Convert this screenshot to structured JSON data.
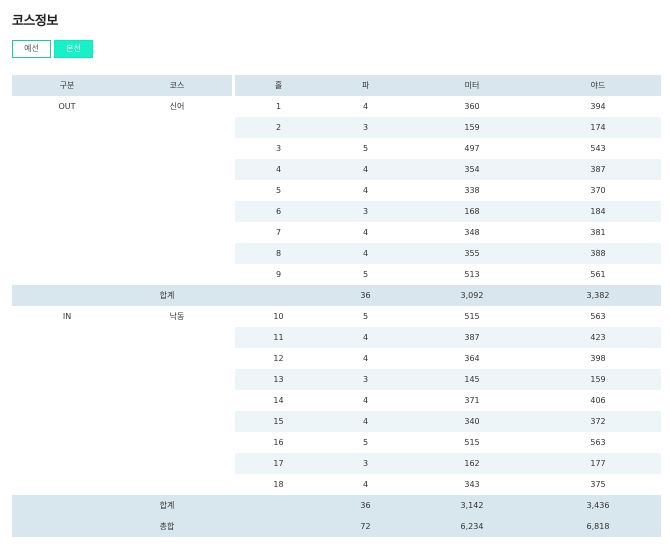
{
  "page": {
    "title": "코스정보"
  },
  "toggle": {
    "prelim_label": "예선",
    "final_label": "본선"
  },
  "table": {
    "headers": {
      "division": "구분",
      "course": "코스",
      "hole": "홀",
      "par": "파",
      "meter": "미터",
      "yard": "야드"
    },
    "out": {
      "division": "OUT",
      "course": "신어",
      "rows": [
        {
          "hole": "1",
          "par": "4",
          "meter": "360",
          "yard": "394"
        },
        {
          "hole": "2",
          "par": "3",
          "meter": "159",
          "yard": "174"
        },
        {
          "hole": "3",
          "par": "5",
          "meter": "497",
          "yard": "543"
        },
        {
          "hole": "4",
          "par": "4",
          "meter": "354",
          "yard": "387"
        },
        {
          "hole": "5",
          "par": "4",
          "meter": "338",
          "yard": "370"
        },
        {
          "hole": "6",
          "par": "3",
          "meter": "168",
          "yard": "184"
        },
        {
          "hole": "7",
          "par": "4",
          "meter": "348",
          "yard": "381"
        },
        {
          "hole": "8",
          "par": "4",
          "meter": "355",
          "yard": "388"
        },
        {
          "hole": "9",
          "par": "5",
          "meter": "513",
          "yard": "561"
        }
      ],
      "subtotal": {
        "label": "합계",
        "par": "36",
        "meter": "3,092",
        "yard": "3,382"
      }
    },
    "in": {
      "division": "IN",
      "course": "낙동",
      "rows": [
        {
          "hole": "10",
          "par": "5",
          "meter": "515",
          "yard": "563"
        },
        {
          "hole": "11",
          "par": "4",
          "meter": "387",
          "yard": "423"
        },
        {
          "hole": "12",
          "par": "4",
          "meter": "364",
          "yard": "398"
        },
        {
          "hole": "13",
          "par": "3",
          "meter": "145",
          "yard": "159"
        },
        {
          "hole": "14",
          "par": "4",
          "meter": "371",
          "yard": "406"
        },
        {
          "hole": "15",
          "par": "4",
          "meter": "340",
          "yard": "372"
        },
        {
          "hole": "16",
          "par": "5",
          "meter": "515",
          "yard": "563"
        },
        {
          "hole": "17",
          "par": "3",
          "meter": "162",
          "yard": "177"
        },
        {
          "hole": "18",
          "par": "4",
          "meter": "343",
          "yard": "375"
        }
      ],
      "subtotal": {
        "label": "합계",
        "par": "36",
        "meter": "3,142",
        "yard": "3,436"
      }
    },
    "total": {
      "label": "총합",
      "par": "72",
      "meter": "6,234",
      "yard": "6,818"
    }
  },
  "colors": {
    "accent": "#18f0c8",
    "header_bg": "#d8e6ee",
    "stripe_bg": "#eef5f9"
  }
}
